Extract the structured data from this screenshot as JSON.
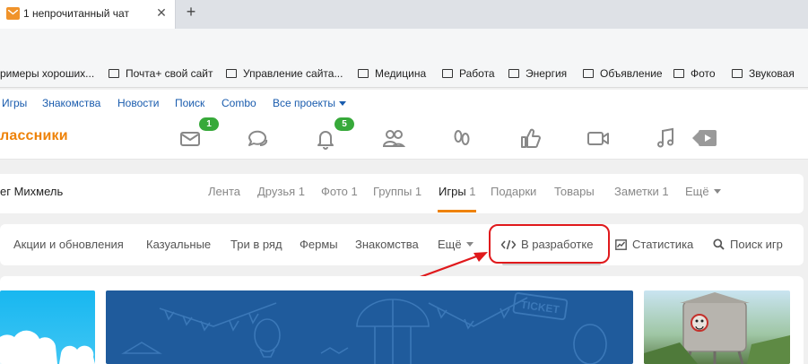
{
  "browser": {
    "tab_title": "1 непрочитанный чат",
    "tab_close": "✕",
    "new_tab": "+",
    "bookmarks": [
      "римеры хороших...",
      "Почта+ свой сайт",
      "Управление сайта...",
      "Медицина",
      "Работа",
      "Энергия",
      "Объявление",
      "Фото",
      "Звуковая"
    ]
  },
  "top_links": {
    "items": [
      "Игры",
      "Знакомства",
      "Новости",
      "Поиск",
      "Combo"
    ],
    "all_projects": "Все проекты"
  },
  "header": {
    "logo_text": "лассники",
    "icons": [
      {
        "name": "messages-icon",
        "badge": "1"
      },
      {
        "name": "discussions-icon",
        "badge": ""
      },
      {
        "name": "notifications-icon",
        "badge": "5"
      },
      {
        "name": "friends-icon",
        "badge": ""
      },
      {
        "name": "guests-icon",
        "badge": ""
      },
      {
        "name": "events-icon",
        "badge": ""
      },
      {
        "name": "video-icon",
        "badge": ""
      },
      {
        "name": "music-icon",
        "badge": ""
      },
      {
        "name": "games-tv-icon",
        "badge": ""
      }
    ],
    "accent_color": "#ee8208",
    "badge_color": "#37a93a"
  },
  "profile": {
    "user_name": "ег Михмель",
    "nav": {
      "feed": "Лента",
      "friends": "Друзья 1",
      "photos": "Фото 1",
      "groups": "Группы 1",
      "games": "Игры",
      "games_count": "1",
      "gifts": "Подарки",
      "goods": "Товары",
      "notes": "Заметки 1",
      "more": "Ещё"
    },
    "active_tab": "Игры"
  },
  "games_nav": {
    "items": {
      "updates": "Акции и обновления",
      "casual": "Казуальные",
      "match3": "Три в ряд",
      "farms": "Фермы",
      "dating": "Знакомства",
      "more": "Ещё",
      "in_dev": "В разработке",
      "stats": "Статистика",
      "search": "Поиск игр"
    },
    "highlighted": "В разработке",
    "highlight_color": "#e0191c"
  },
  "tiles": {
    "ticket_text": "TICKET"
  }
}
